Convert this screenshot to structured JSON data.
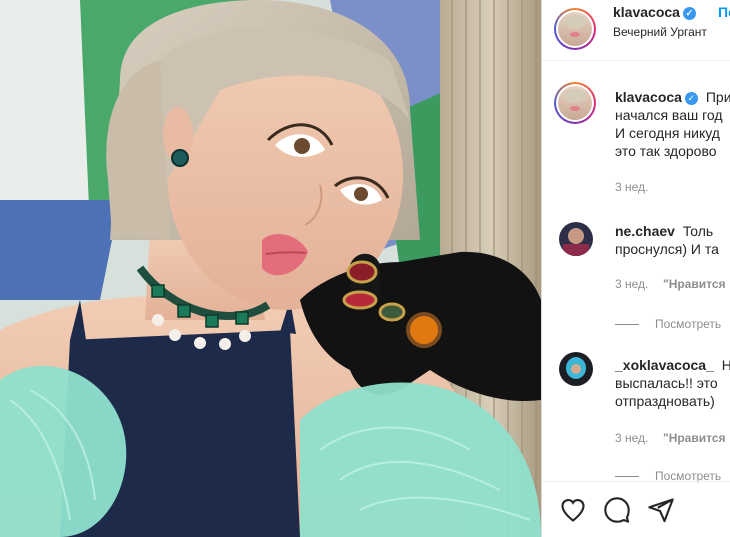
{
  "post": {
    "username": "klavacoca",
    "follow_label": "По",
    "location": "Вечерний Ургант"
  },
  "caption": {
    "username": "klavacoca",
    "lines": [
      "При",
      "начался ваш год",
      "И сегодня никуд",
      "это так здорово"
    ],
    "time": "3 нед."
  },
  "comments": [
    {
      "username": "ne.chaev",
      "lines": [
        "Толь",
        "проснулся) И та"
      ],
      "time": "3 нед.",
      "like_label": "\"Нравится",
      "replies_label": "Посмотреть"
    },
    {
      "username": "_xoklavacoca_",
      "lines": [
        "Ну",
        "выспалась!! это",
        "отпраздновать)"
      ],
      "time": "3 нед.",
      "like_label": "\"Нравится",
      "replies_label": "Посмотреть"
    }
  ],
  "icons": {
    "like": "heart-icon",
    "comment": "comment-icon",
    "share": "share-icon",
    "verified": "verified-badge-icon"
  },
  "colors": {
    "accent": "#0095f6",
    "verified": "#3897f0",
    "text": "#262626",
    "muted": "#8e8e8e"
  }
}
